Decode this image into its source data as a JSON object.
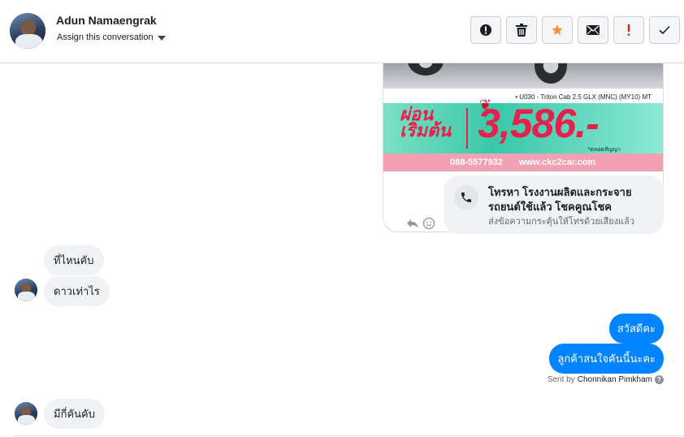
{
  "header": {
    "contact_name": "Adun Namaengrak",
    "assign_label": "Assign this conversation"
  },
  "toolbar": {
    "buttons": [
      {
        "name": "spam",
        "icon": "exclamation-circle-icon"
      },
      {
        "name": "delete",
        "icon": "trash-icon"
      },
      {
        "name": "star",
        "icon": "star-icon",
        "color": "#f7923a"
      },
      {
        "name": "mark-unread",
        "icon": "envelope-icon"
      },
      {
        "name": "follow-up",
        "icon": "exclamation-icon",
        "color": "#e02020"
      },
      {
        "name": "mark-done",
        "icon": "checkmark-icon"
      }
    ]
  },
  "attachment": {
    "model_text": "• U030 - Triton Cab 2.5 GLX (MNC) (MY10) MT",
    "promo_left": "ผ่อน เริ่มต้น",
    "price": "3,586.-",
    "price_note": "*ตลอดสัญญา",
    "phone": "088-5577932",
    "website": "www.ckc2car.com"
  },
  "call_card": {
    "title": "โทรหา โรงงานผลิตและกระจาย รถยนต์ใช้แล้ว โชคคูณโชค",
    "subtitle": "ส่งข้อความกระตุ้นให้โทรด้วยเสียงแล้ว"
  },
  "messages": [
    {
      "from": "customer",
      "text": "ที่ไหนคับ"
    },
    {
      "from": "customer",
      "text": "ดาวเท่าไร"
    },
    {
      "from": "page",
      "text": "สวัสดีคะ"
    },
    {
      "from": "page",
      "text": "ลูกค้าสนใจคันนี้นะคะ"
    },
    {
      "from": "customer",
      "text": "มีกี่คันคับ"
    }
  ],
  "seen": {
    "prefix": "Sent by",
    "sender": "Chonnikan Pimkham",
    "help": "?"
  },
  "colors": {
    "outgoing_bubble": "#0084ff",
    "incoming_bubble": "#f0f2f5"
  }
}
